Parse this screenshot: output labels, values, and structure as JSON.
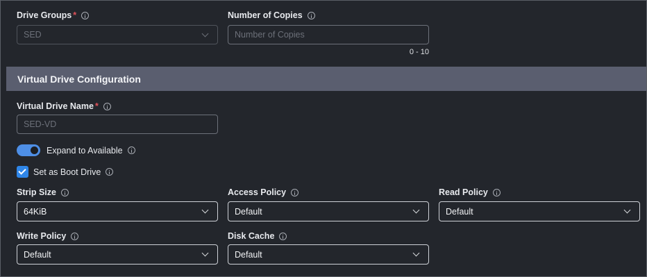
{
  "drive_groups": {
    "label": "Drive Groups",
    "required_mark": "*",
    "value": "SED"
  },
  "number_of_copies": {
    "label": "Number of Copies",
    "placeholder": "Number of Copies",
    "range": "0 - 10"
  },
  "section": {
    "title": "Virtual Drive Configuration"
  },
  "virtual_drive_name": {
    "label": "Virtual Drive Name",
    "required_mark": "*",
    "placeholder": "SED-VD"
  },
  "expand_to_available": {
    "label": "Expand to Available",
    "enabled": true
  },
  "set_as_boot_drive": {
    "label": "Set as Boot Drive",
    "checked": true
  },
  "strip_size": {
    "label": "Strip Size",
    "value": "64KiB"
  },
  "access_policy": {
    "label": "Access Policy",
    "value": "Default"
  },
  "read_policy": {
    "label": "Read Policy",
    "value": "Default"
  },
  "write_policy": {
    "label": "Write Policy",
    "value": "Default"
  },
  "disk_cache": {
    "label": "Disk Cache",
    "value": "Default"
  },
  "colors": {
    "accent": "#2f86e8",
    "section_bar": "#5a5e6f",
    "required": "#e0525a",
    "background": "#23262c"
  },
  "icons": [
    "info-icon",
    "chevron-down-icon",
    "checkmark-icon"
  ]
}
